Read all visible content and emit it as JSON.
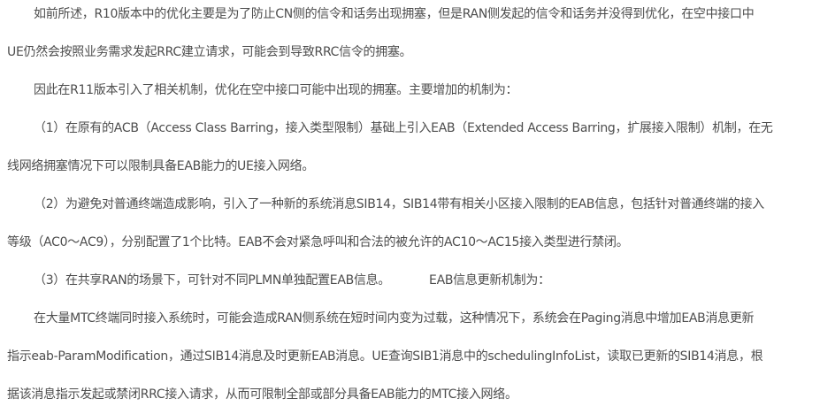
{
  "article": {
    "p1": {
      "line1": "如前所述，R10版本中的优化主要是为了防止CN侧的信令和话务出现拥塞，但是RAN侧发起的信令和话务并没得到优化，在空中接口中",
      "line2": "UE仍然会按照业务需求发起RRC建立请求，可能会到导致RRC信令的拥塞。"
    },
    "p2": {
      "line1": "因此在R11版本引入了相关机制，优化在空中接口可能中出现的拥塞。主要增加的机制为："
    },
    "p3": {
      "line1": "（1）在原有的ACB（Access Class Barring，接入类型限制）基础上引入EAB（Extended Access Barring，扩展接入限制）机制，在无",
      "line2": "线网络拥塞情况下可以限制具备EAB能力的UE接入网络。"
    },
    "p4": {
      "line1": "（2）为避免对普通终端造成影响，引入了一种新的系统消息SIB14，SIB14带有相关小区接入限制的EAB信息，包括针对普通终端的接入",
      "line2": "等级（AC0～AC9），分别配置了1个比特。EAB不会对紧急呼叫和合法的被允许的AC10～AC15接入类型进行禁闭。"
    },
    "p5": {
      "part1": "（3）在共享RAN的场景下，可针对不同PLMN单独配置EAB信息。",
      "part2": "EAB信息更新机制为："
    },
    "p6": {
      "line1": "在大量MTC终端同时接入系统时，可能会造成RAN侧系统在短时间内变为过载，这种情况下，系统会在Paging消息中增加EAB消息更新",
      "line2": "指示eab-ParamModification，通过SIB14消息及时更新EAB消息。UE查询SIB1消息中的schedulingInfoList，读取已更新的SIB14消息，根",
      "line3": "据该消息指示发起或禁闭RRC接入请求，从而可限制全部或部分具备EAB能力的MTC接入网络。"
    }
  }
}
